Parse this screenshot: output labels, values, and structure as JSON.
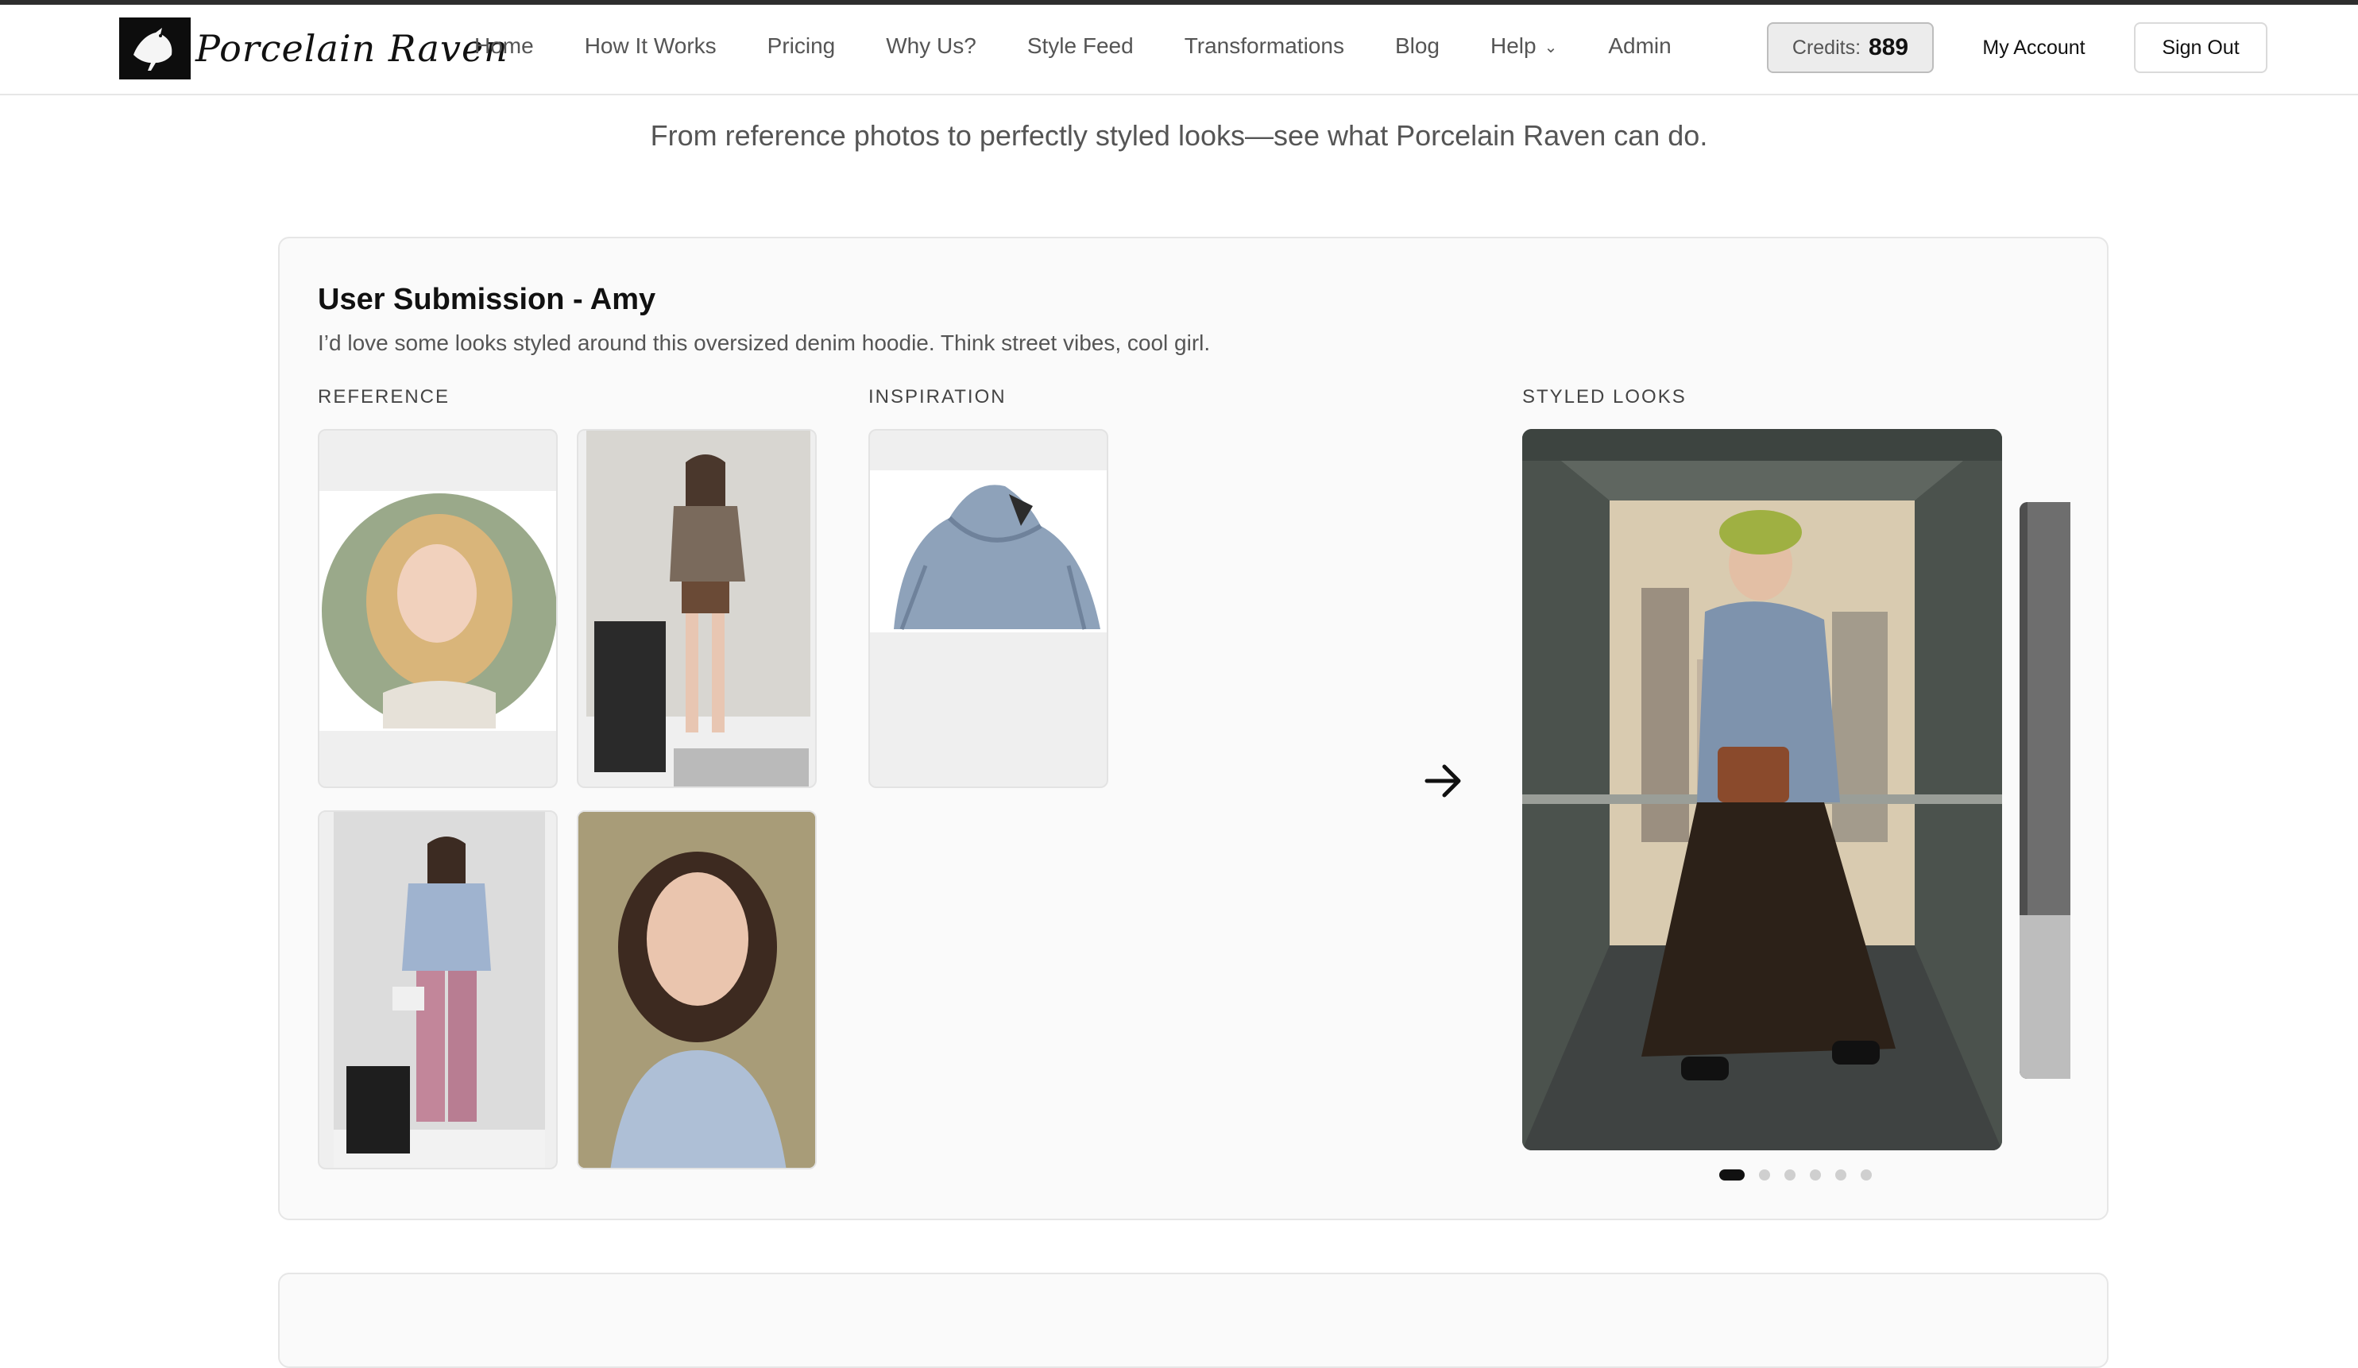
{
  "brand": {
    "name": "Porcelain Raven"
  },
  "nav": {
    "items": [
      "Home",
      "How It Works",
      "Pricing",
      "Why Us?",
      "Style Feed",
      "Transformations",
      "Blog",
      "Help",
      "Admin"
    ]
  },
  "account": {
    "credits_label": "Credits:",
    "credits_value": "889",
    "my_account": "My Account",
    "sign_out": "Sign Out"
  },
  "page": {
    "tagline": "From reference photos to perfectly styled looks—see what Porcelain Raven can do."
  },
  "submission": {
    "title": "User Submission - Amy",
    "description": "I’d love some looks styled around this oversized denim hoodie. Think street vibes, cool girl.",
    "reference_label": "REFERENCE",
    "inspiration_label": "INSPIRATION",
    "styled_label": "STYLED LOOKS",
    "styled_total": 6,
    "styled_active_index": 0
  },
  "icons": {
    "arrow": "arrow-right-icon",
    "help_dropdown": "chevron-down-icon"
  },
  "colors": {
    "accent": "#111111",
    "card_bg": "#fafafa",
    "border": "#e6e6e6"
  }
}
